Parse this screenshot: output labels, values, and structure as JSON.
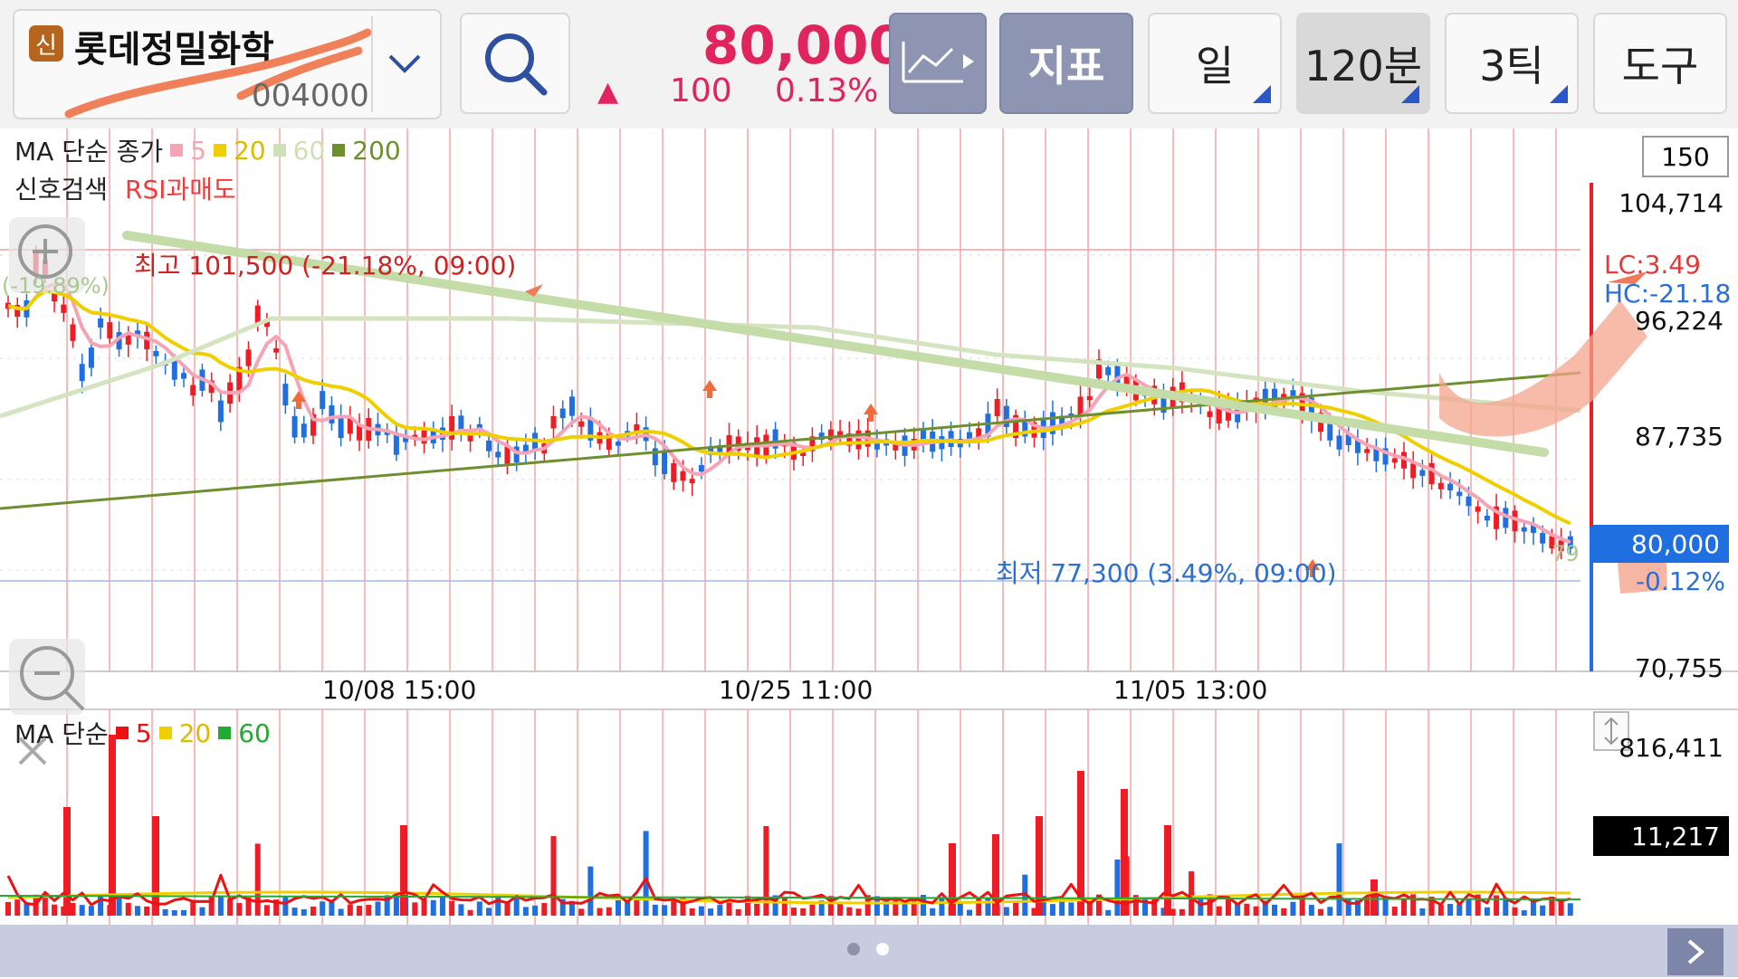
{
  "header": {
    "badge": "신",
    "stock_name": "롯데정밀화학",
    "stock_code": "004000",
    "price": "80,000",
    "change_arrow": "▲",
    "change": "100",
    "change_pct": "0.13%",
    "buttons": {
      "indicator": "지표",
      "period_day": "일",
      "period_min": "120분",
      "tick": "3틱",
      "tools": "도구"
    }
  },
  "price_panel": {
    "legend_ma": "MA 단순 종가",
    "ma_items": [
      {
        "label": "5",
        "color": "#f5a4b5"
      },
      {
        "label": "20",
        "color": "#f0cf00"
      },
      {
        "label": "60",
        "color": "#cfe0b8"
      },
      {
        "label": "200",
        "color": "#6e8f2e"
      }
    ],
    "signal_label": "신호검색",
    "signal_value": "RSI과매도",
    "count_box": "150",
    "y_axis": [
      "104,714",
      "96,224",
      "87,735",
      "80,000",
      "70,755"
    ],
    "lc": "LC:3.49",
    "hc": "HC:-21.18",
    "current_pct": "-0.12%",
    "high_annotation": "최고 101,500 (-21.18%, 09:00)",
    "low_annotation": "최저 77,300 (3.49%, 09:00)",
    "left_pct": "(-19.89%)",
    "right_pct": "79",
    "x_axis": [
      "10/08 15:00",
      "10/25 11:00",
      "11/05 13:00"
    ]
  },
  "volume_panel": {
    "legend_ma": "MA 단순",
    "ma_items": [
      {
        "label": "5",
        "color": "#ee1111"
      },
      {
        "label": "20",
        "color": "#f0cf00"
      },
      {
        "label": "60",
        "color": "#22aa33"
      }
    ],
    "y_max": "816,411",
    "current_volume": "11,217"
  },
  "colors": {
    "up": "#ee1c25",
    "down": "#1f6fe0",
    "grid_red": "#f3a7a7",
    "price_highlight": "#1f6fe0",
    "footer": "#c7ccde"
  },
  "footer": {
    "next_icon": "chevron-right-icon"
  }
}
